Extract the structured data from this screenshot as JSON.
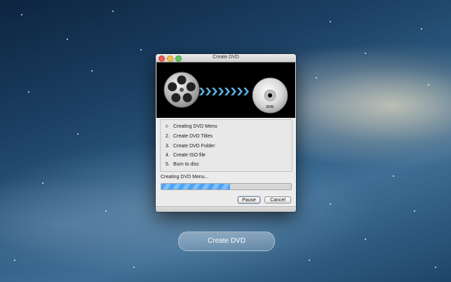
{
  "window": {
    "title": "Create DVD",
    "steps": [
      {
        "marker": "⊪",
        "label": "Creating DVD Menu",
        "active": true
      },
      {
        "marker": "2.",
        "label": "Create DVD Titles",
        "active": false
      },
      {
        "marker": "3.",
        "label": "Create DVD Folder",
        "active": false
      },
      {
        "marker": "4.",
        "label": "Create ISO file",
        "active": false
      },
      {
        "marker": "5.",
        "label": "Burn to disc",
        "active": false
      }
    ],
    "status": "Creating DVD Menu...",
    "progress": 0.53,
    "buttons": {
      "pause": "Pause",
      "cancel": "Cancel"
    },
    "disc_label": "DVD"
  },
  "main_button": "Create DVD",
  "colors": {
    "accent": "#5aa8d8",
    "progress": "#4ea3f3"
  },
  "icons": [
    "film-reel-icon",
    "arrow-chevrons-icon",
    "dvd-disc-icon",
    "spinner-icon"
  ]
}
